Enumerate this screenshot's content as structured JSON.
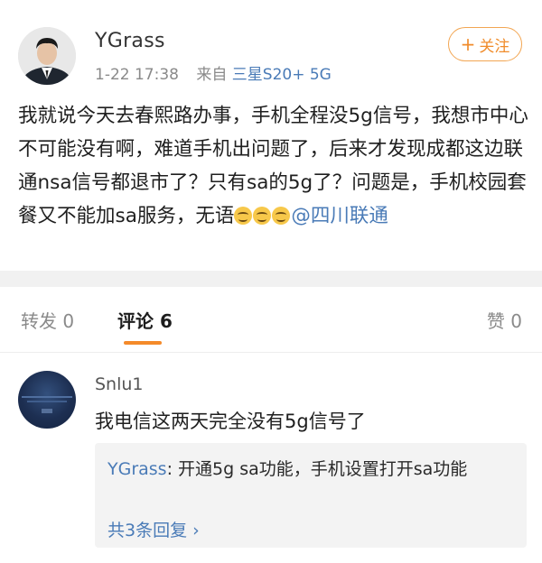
{
  "post": {
    "username": "YGrass",
    "time": "1-22 17:38",
    "source_prefix": "来自",
    "source_device": "三星S20+ 5G",
    "follow_label": "关注",
    "text_part1": "我就说今天去春熙路办事，手机全程没5g信号，我想市中心不可能没有啊，难道手机出问题了，后来才发现成都这边联通nsa信号都退市了？只有sa的5g了？问题是，手机校园套餐又不能加sa服务，无语",
    "mention": "@四川联通",
    "emoji_icon": "grimace-emoji"
  },
  "tabs": {
    "reposts": "转发 0",
    "comments": "评论 6",
    "likes": "赞 0",
    "active_color": "#f48a2a"
  },
  "comment": {
    "username": "Snlu1",
    "text": "我电信这两天完全没有5g信号了",
    "reply": {
      "author": "YGrass",
      "text": ": 开通5g sa功能，手机设置打开sa功能",
      "more": "共3条回复"
    }
  },
  "colors": {
    "link": "#4a7bb7",
    "accent": "#f08c2b"
  }
}
